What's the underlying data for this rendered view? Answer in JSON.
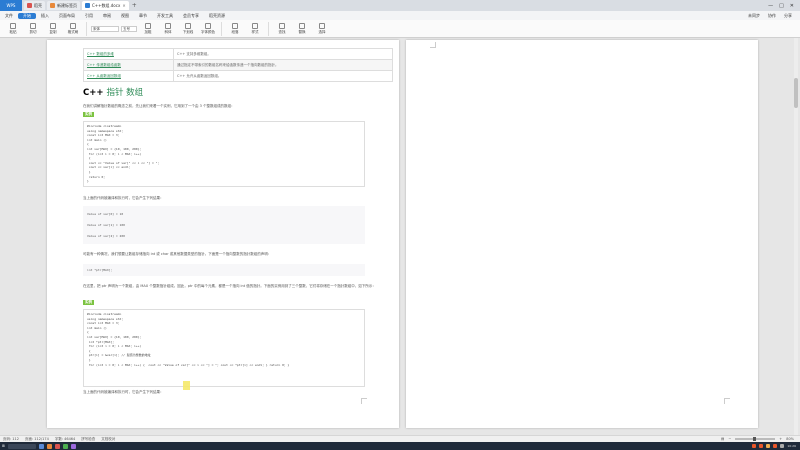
{
  "tabs": {
    "app_label": "WPS",
    "items": [
      {
        "label": "稻壳",
        "color": "#d9534f"
      },
      {
        "label": "新建标签页",
        "color": "#e8893a"
      },
      {
        "label": "C++数组.docx",
        "color": "#2b7cd3"
      }
    ],
    "add": "+",
    "controls": [
      "—",
      "□",
      "✕"
    ]
  },
  "menu": {
    "items": [
      "文件",
      "开始",
      "插入",
      "页面布局",
      "引用",
      "审阅",
      "视图",
      "章节",
      "开发工具",
      "会员专享",
      "稻壳资源"
    ],
    "active_index": 1,
    "right": [
      "未同步",
      "协作",
      "分享"
    ]
  },
  "toolbar": {
    "buttons": [
      "粘贴",
      "剪切",
      "复制",
      "格式刷",
      "加粗",
      "斜体",
      "下划线",
      "字体颜色",
      "段落",
      "样式",
      "查找",
      "替换",
      "选择"
    ],
    "font": "宋体",
    "size": "五号"
  },
  "document": {
    "table": [
      {
        "fn": "C++ 数组的多维",
        "desc": "C++ 支持多维数组。"
      },
      {
        "fn": "C++ 传递数组给函数",
        "desc": "通过指定不带索引的数组名称来给函数传递一个指向数组的指针。"
      },
      {
        "fn": "C++ 从函数返回数组",
        "desc": "C++ 允许从函数返回数组。"
      }
    ],
    "heading_en": "C++ ",
    "heading_zh": "指针 数组",
    "intro": "在我们讲解指针数组的概念之前，先让我们来看一个实例，它用到了一个由 3 个整数组成的数组：",
    "tag1": "实例",
    "code1": "#include <iostream>\nusing namespace std;\nconst int MAX = 3;\nint main ()\n{\nint var[MAX] = {10, 100, 200};\n for (int i = 0; i < MAX; i++)\n {\n cout << \"Value of var[\" << i << \"] = \";\n cout << var[i] << endl;\n }\n return 0;\n}",
    "after1": "当上面的代码被编译和执行时，它会产生下列结果：",
    "output": "Value of var[0] = 10\nValue of var[1] = 100\nValue of var[2] = 200",
    "explain": "可能有一种情况，我们想要让数组存储指向 int 或 char 或其他数据类型的指针。下面是一个指向整数的指针数组的声明：",
    "decl": "int *ptr[MAX];",
    "explain2": "在这里，把 ptr 声明为一个数组，由 MAX 个整数指针组成。因此，ptr 中的每个元素，都是一个指向 int 值的指针。下面的实例用到了三个整数，它们将存储在一个指针数组中，如下所示：",
    "tag2": "实例",
    "code2": "#include <iostream>\nusing namespace std;\nconst int MAX = 3;\nint main ()\n{\nint var[MAX] = {10, 100, 200};\n int *ptr[MAX];\n for (int i = 0; i < MAX; i++)\n {\n ptr[i] = &var[i]; // 赋值为整数的地址\n }\n for (int i = 0; i < MAX; i++) {  cout << \"Value of var[\" << i << \"] = \"; cout << *ptr[i] << endl; } return 0; }",
    "after2": "当上面的代码被编译和执行时，它会产生下列结果："
  },
  "status": {
    "left": [
      "页码: 112",
      "页面: 112/174",
      "字数: 46464",
      "拼写检查",
      "文档校对"
    ],
    "zoom": "80%"
  },
  "taskbar": {
    "clock": "10:26"
  }
}
